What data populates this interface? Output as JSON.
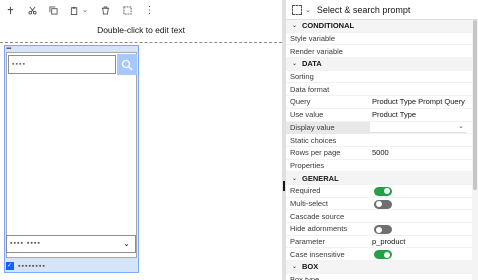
{
  "canvas": {
    "hint_text": "Double-click to edit text",
    "prompt_tag": "▪▪▪",
    "search_placeholder": "▪▪▪▪",
    "select_value": "▪▪▪▪ ▪▪▪▪",
    "checkbox_label": "▪▪▪▪▪▪▪▪",
    "toolbar_icons": [
      "pin-icon",
      "cut-icon",
      "copy-icon",
      "paste-icon",
      "dropdown-chevron-icon",
      "delete-icon",
      "select-frame-icon",
      "more-icon"
    ]
  },
  "panel": {
    "title": "Select & search prompt",
    "sections": {
      "conditional": "CONDITIONAL",
      "data": "DATA",
      "general": "GENERAL",
      "box": "BOX"
    },
    "properties": {
      "style_variable": "Style variable",
      "render_variable": "Render variable",
      "sorting": "Sorting",
      "data_format": "Data format",
      "query_label": "Query",
      "query_value": "Product Type Prompt Query",
      "use_value_label": "Use value",
      "use_value_value": "Product Type",
      "display_value": "Display value",
      "static_choices": "Static choices",
      "rows_per_page_label": "Rows per page",
      "rows_per_page_value": "5000",
      "properties_label": "Properties",
      "required": "Required",
      "multi_select": "Multi-select",
      "cascade_source": "Cascade source",
      "hide_adornments": "Hide adornments",
      "parameter_label": "Parameter",
      "parameter_value": "p_product",
      "case_insensitive": "Case insensitive",
      "box_type": "Box type"
    },
    "toggles": {
      "required": true,
      "multi_select": false,
      "hide_adornments": false,
      "case_insensitive": true
    }
  },
  "colors": {
    "accent": "#0f62fe",
    "toggle_on": "#24a148",
    "toggle_off": "#6f6f6f",
    "selection_fill": "#d6e4f7",
    "search_button": "#a6c8ff"
  }
}
